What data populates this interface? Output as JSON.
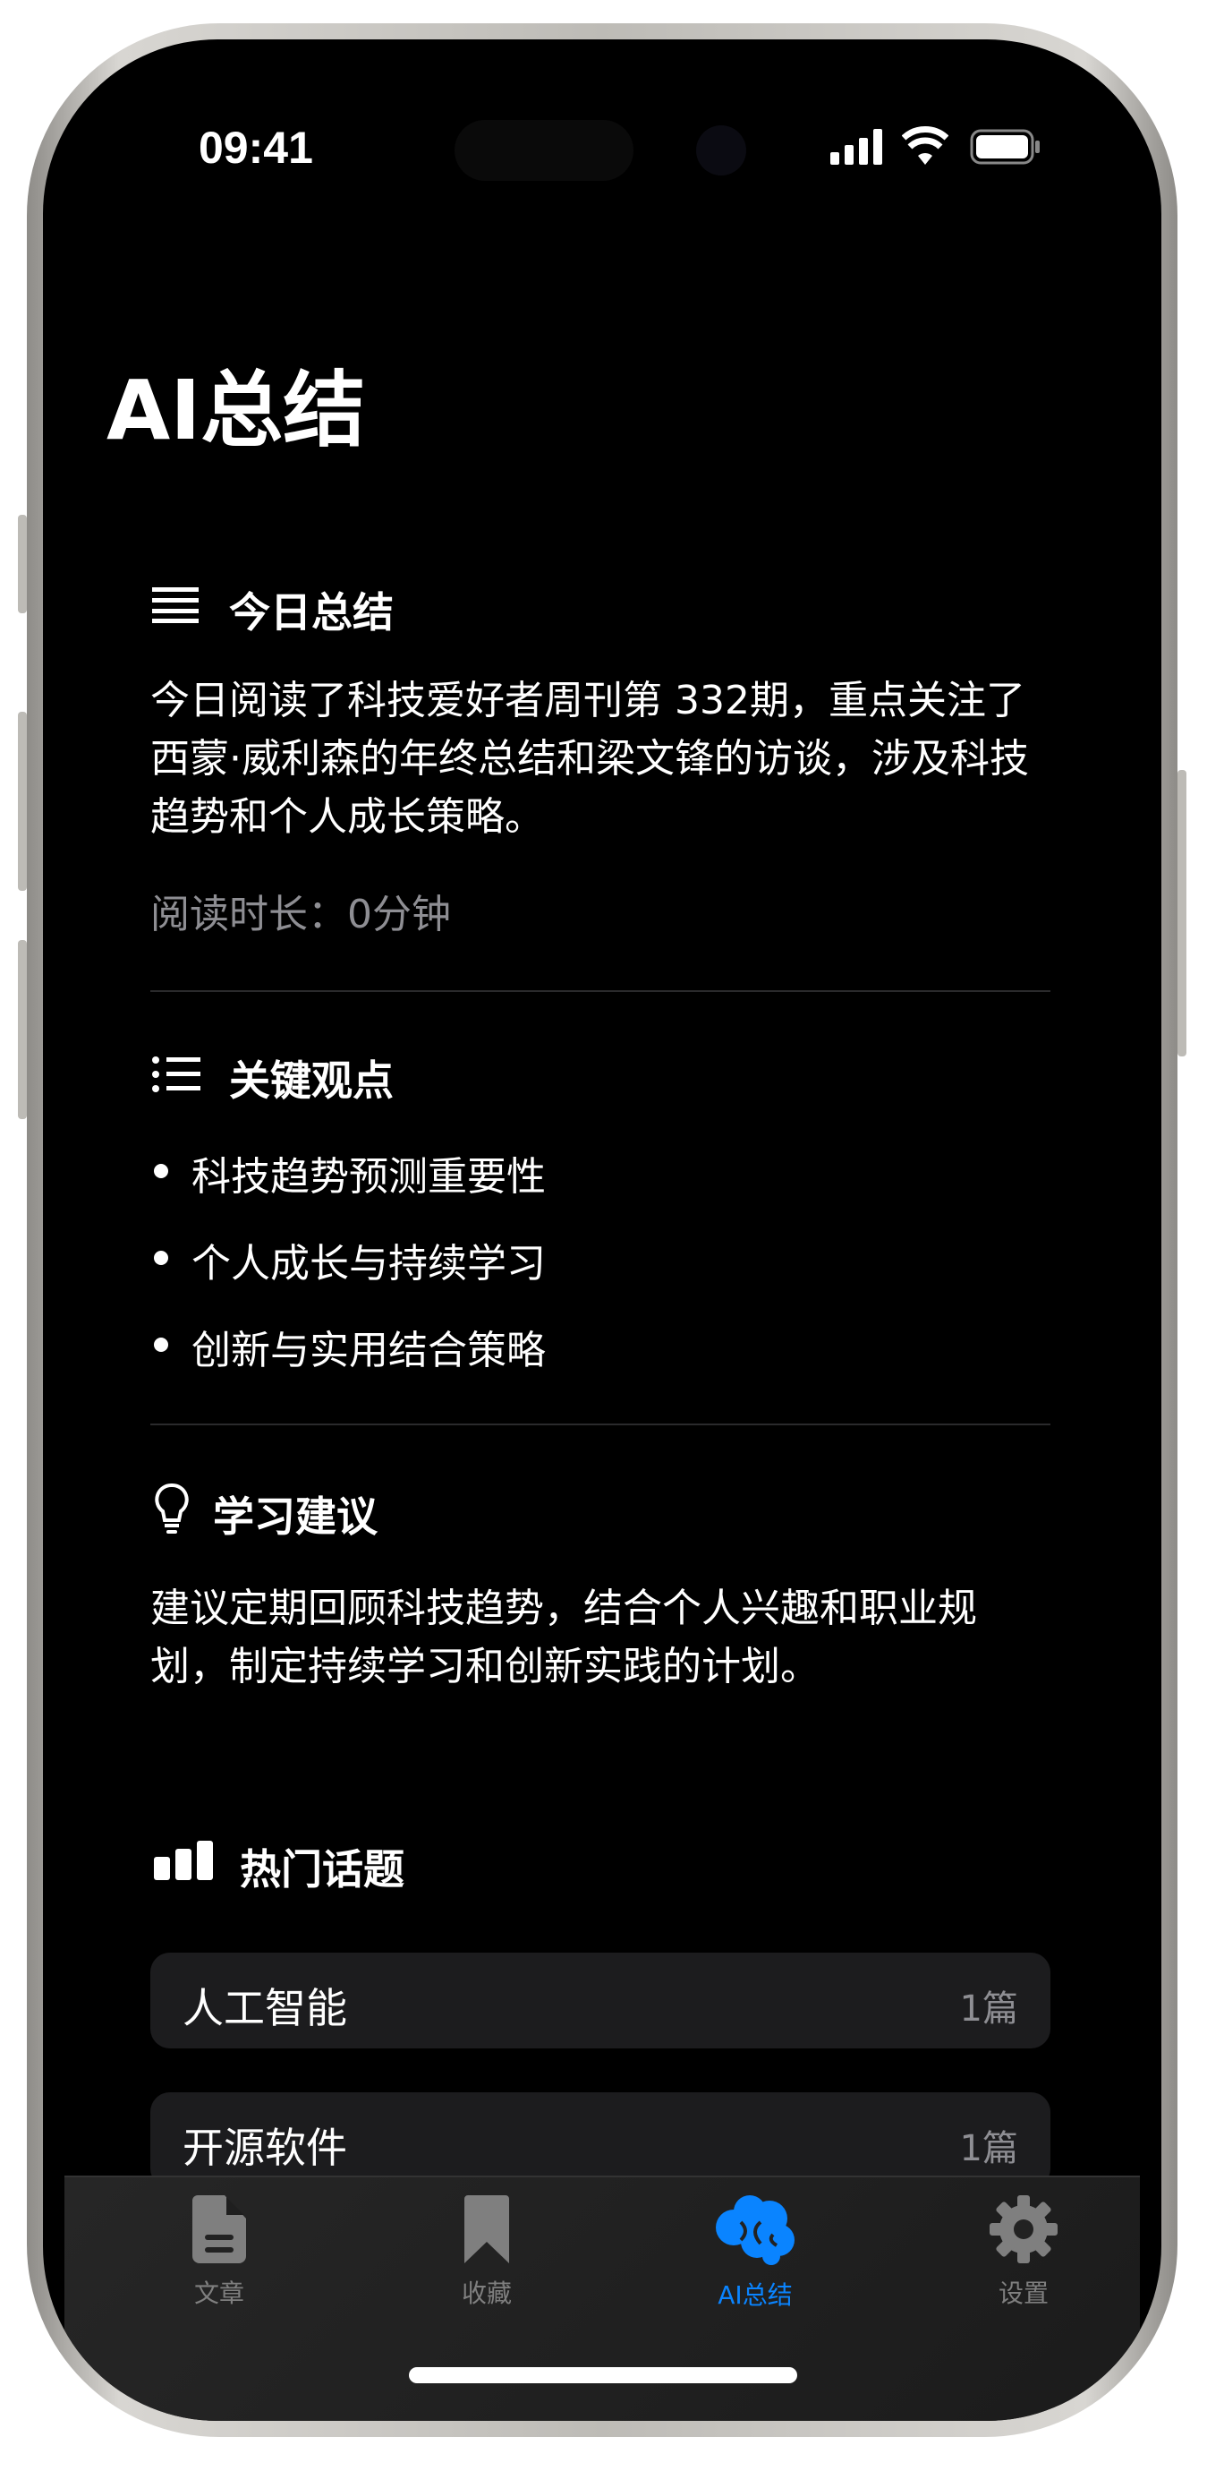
{
  "status_bar": {
    "time": "09:41"
  },
  "page_title": "AI总结",
  "today_summary": {
    "heading": "今日总结",
    "icon": "text-lines-icon",
    "body": "今日阅读了科技爱好者周刊第 332期，重点关注了西蒙·威利森的年终总结和梁文锋的访谈，涉及科技趋势和个人成长策略。",
    "reading_time": "阅读时长：0分钟"
  },
  "key_points": {
    "heading": "关键观点",
    "icon": "list-bullet-icon",
    "items": [
      "科技趋势预测重要性",
      "个人成长与持续学习",
      "创新与实用结合策略"
    ]
  },
  "learning_advice": {
    "heading": "学习建议",
    "icon": "lightbulb-icon",
    "body": "建议定期回顾科技趋势，结合个人兴趣和职业规划，制定持续学习和创新实践的计划。"
  },
  "hot_topics": {
    "heading": "热门话题",
    "icon": "chart-bar-icon",
    "items": [
      {
        "name": "人工智能",
        "count": "1篇"
      },
      {
        "name": "开源软件",
        "count": "1篇"
      }
    ]
  },
  "tab_bar": {
    "active_color": "#0a84ff",
    "tabs": [
      {
        "label": "文章",
        "icon": "document-icon"
      },
      {
        "label": "收藏",
        "icon": "bookmark-icon"
      },
      {
        "label": "AI总结",
        "icon": "brain-icon",
        "active": true
      },
      {
        "label": "设置",
        "icon": "gear-icon"
      }
    ]
  }
}
